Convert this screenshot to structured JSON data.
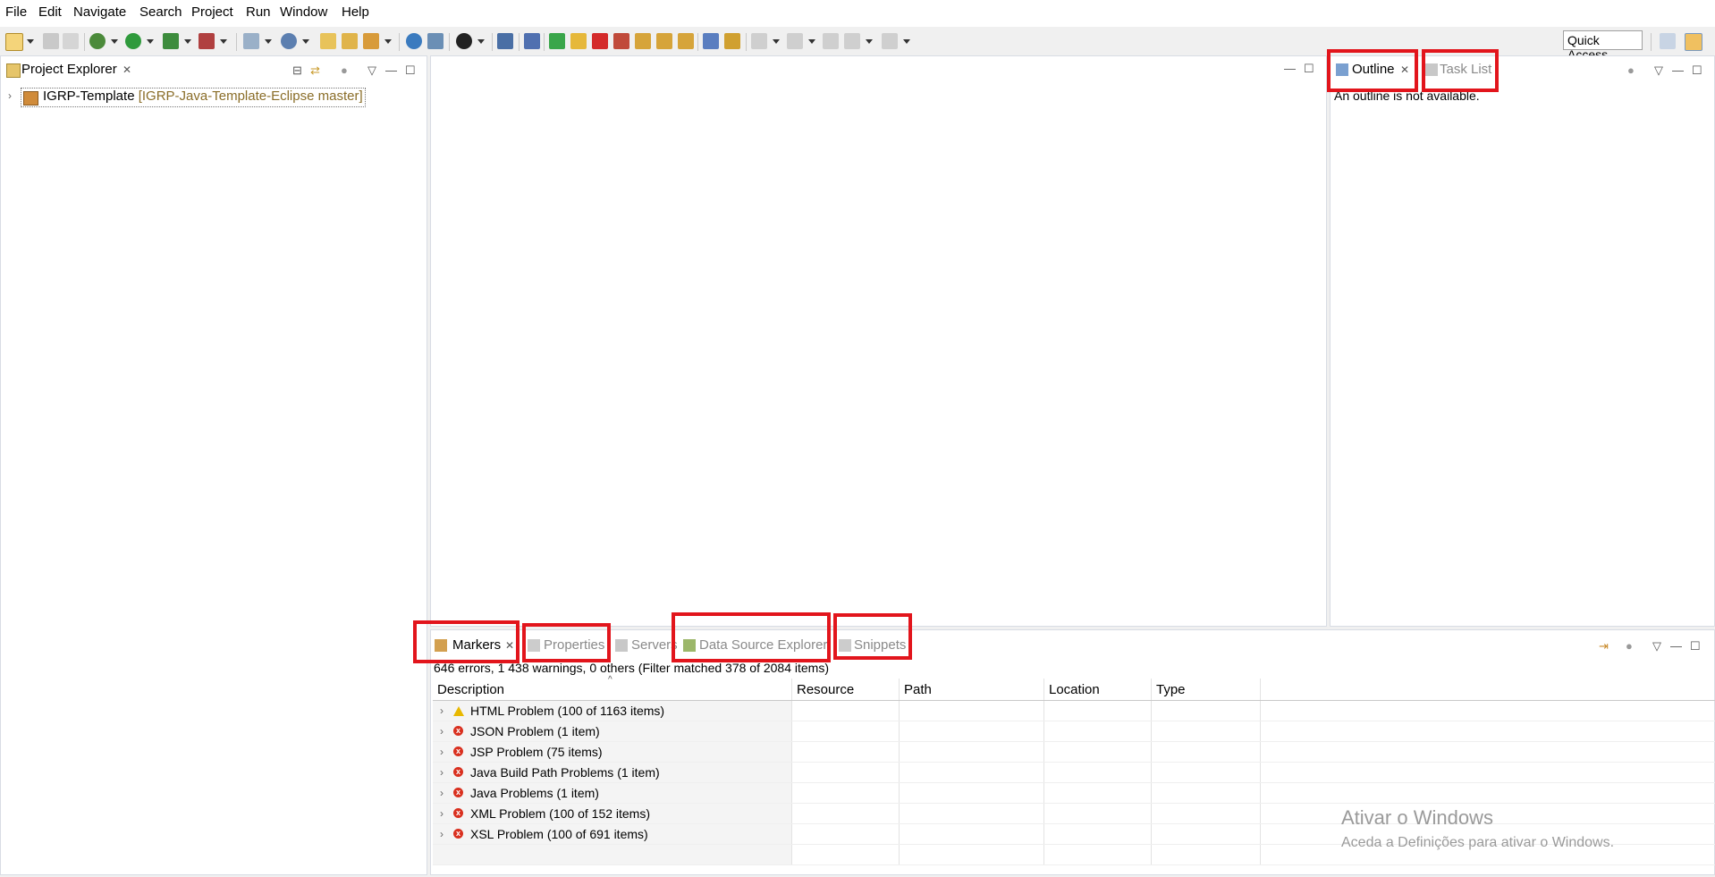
{
  "menu": [
    "File",
    "Edit",
    "Navigate",
    "Search",
    "Project",
    "Run",
    "Window",
    "Help"
  ],
  "toolbar": {
    "quick_access": "Quick Access"
  },
  "project_explorer": {
    "title": "Project Explorer",
    "project_name": "IGRP-Template",
    "project_repo": "[IGRP-Java-Template-Eclipse master]"
  },
  "outline": {
    "tab_outline": "Outline",
    "tab_task_list": "Task List",
    "message": "An outline is not available."
  },
  "bottom": {
    "tabs": [
      "Markers",
      "Properties",
      "Servers",
      "Data Source Explorer",
      "Snippets"
    ],
    "summary": "646 errors, 1 438 warnings, 0 others (Filter matched 378 of 2084 items)",
    "columns": [
      "Description",
      "Resource",
      "Path",
      "Location",
      "Type"
    ],
    "rows": [
      {
        "icon": "warning",
        "label": "HTML Problem (100 of 1163 items)"
      },
      {
        "icon": "error",
        "label": "JSON Problem (1 item)"
      },
      {
        "icon": "error",
        "label": "JSP Problem (75 items)"
      },
      {
        "icon": "error",
        "label": "Java Build Path Problems (1 item)"
      },
      {
        "icon": "error",
        "label": "Java Problems (1 item)"
      },
      {
        "icon": "error",
        "label": "XML Problem (100 of 152 items)"
      },
      {
        "icon": "error",
        "label": "XSL Problem (100 of 691 items)"
      }
    ]
  },
  "watermark": {
    "line1": "Ativar o Windows",
    "line2": "Aceda a Definições para ativar o Windows."
  },
  "colors": {
    "highlight": "#e2151c",
    "repo_text": "#8a6d28"
  }
}
